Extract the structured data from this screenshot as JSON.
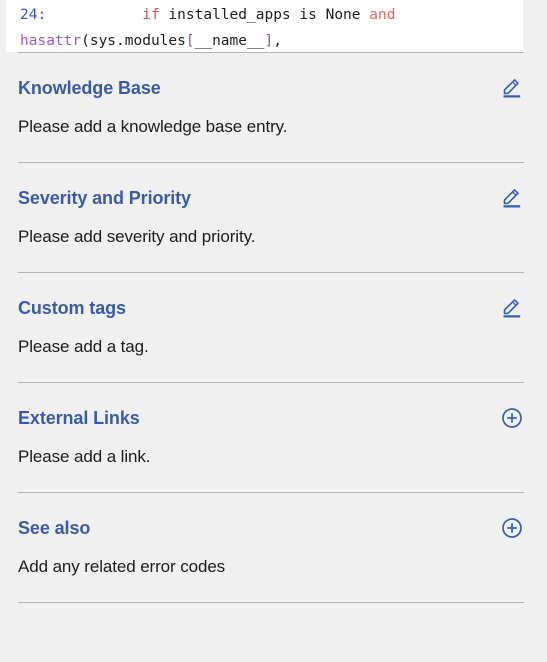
{
  "code_snippet": {
    "name": "traceback-code-frame",
    "lines": [
      {
        "tokens": [
          {
            "text": "24:",
            "type": "lineno"
          },
          {
            "text": "           ",
            "type": "plain"
          },
          {
            "text": "if",
            "type": "kw"
          },
          {
            "text": " installed_apps ",
            "type": "plain"
          },
          {
            "text": "is",
            "type": "plain"
          },
          {
            "text": " None ",
            "type": "plain"
          },
          {
            "text": "and",
            "type": "op"
          }
        ]
      },
      {
        "tokens": [
          {
            "text": "hasattr",
            "type": "fn"
          },
          {
            "text": "(sys.modules",
            "type": "plain"
          },
          {
            "text": "[",
            "type": "br"
          },
          {
            "text": "__name__",
            "type": "plain"
          },
          {
            "text": "]",
            "type": "br"
          },
          {
            "text": ",",
            "type": "plain"
          }
        ]
      }
    ],
    "plain_text_line_1": "24:           if installed_apps is None and",
    "plain_text_line_2": "hasattr(sys.modules[__name__],"
  },
  "colors": {
    "page_background": "#f0f0f0",
    "code_background": "#ffffff",
    "heading": "#3c5aa6",
    "body_text": "#1c1c1c",
    "divider": "#b4b4b4",
    "icon": "#3361ad",
    "icon_accent": "#7a4fb5"
  },
  "sections": [
    {
      "id": "knowledge-base",
      "title": "Knowledge Base",
      "body": "Please add a knowledge base entry.",
      "action_icon": "edit-pencil-icon",
      "action_label": "Edit"
    },
    {
      "id": "severity-and-priority",
      "title": "Severity and Priority",
      "body": "Please add severity and priority.",
      "action_icon": "edit-pencil-icon",
      "action_label": "Edit"
    },
    {
      "id": "custom-tags",
      "title": "Custom tags",
      "body": "Please add a tag.",
      "action_icon": "edit-pencil-icon",
      "action_label": "Edit"
    },
    {
      "id": "external-links",
      "title": "External Links",
      "body": "Please add a link.",
      "action_icon": "plus-circle-icon",
      "action_label": "Add"
    },
    {
      "id": "see-also",
      "title": "See also",
      "body": "Add any related error codes",
      "action_icon": "plus-circle-icon",
      "action_label": "Add"
    }
  ]
}
